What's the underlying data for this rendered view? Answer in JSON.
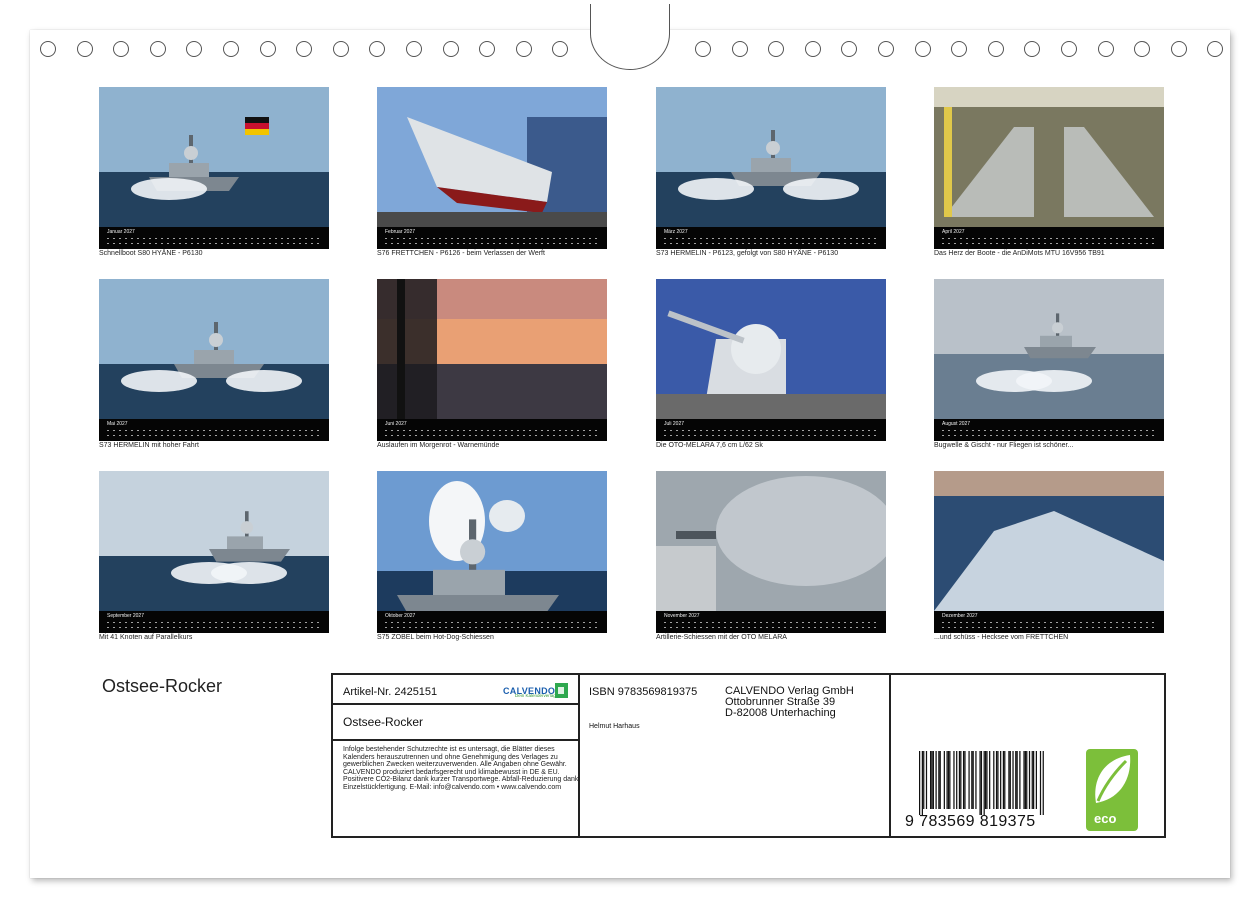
{
  "calendar": {
    "title": "Ostsee-Rocker",
    "months": [
      {
        "name": "Januar 2027",
        "caption": "Schnellboot S80 HYÄNE - P6130",
        "scene": "ship-flag"
      },
      {
        "name": "Februar 2027",
        "caption": "S76 FRETTCHEN  - P6126 - beim Verlassen der Werft",
        "scene": "shipyard"
      },
      {
        "name": "März 2027",
        "caption": "S73 HERMELIN - P6123, gefolgt von S80 HYÄNE - P6130",
        "scene": "ship-splash"
      },
      {
        "name": "April 2027",
        "caption": "Das Herz der Boote - die AnDiMots MTU 16V956 TB91",
        "scene": "engine-room"
      },
      {
        "name": "Mai 2027",
        "caption": "S73 HERMELIN mit hoher Fahrt",
        "scene": "ship-splash"
      },
      {
        "name": "Juni 2027",
        "caption": "Auslaufen im Morgenrot - Warnemünde",
        "scene": "sunset"
      },
      {
        "name": "Juli 2027",
        "caption": "Die OTO-MELARA 7,6 cm L/62 Sk",
        "scene": "gun"
      },
      {
        "name": "August 2027",
        "caption": "Bugwelle & Gischt - nur Fliegen ist schöner...",
        "scene": "ship-spray"
      },
      {
        "name": "September 2027",
        "caption": "Mit 41 Knoten auf Parallelkurs",
        "scene": "ship-fast"
      },
      {
        "name": "Oktober 2027",
        "caption": "S75 ZOBEL beim Hot-Dog-Schiessen",
        "scene": "smoke"
      },
      {
        "name": "November 2027",
        "caption": "Artillerie-Schiessen mit der OTO MELARA",
        "scene": "fog"
      },
      {
        "name": "Dezember 2027",
        "caption": "...und schüss - Hecksee vom FRETTCHEN",
        "scene": "wake"
      }
    ]
  },
  "info": {
    "article": "Artikel-Nr. 2425151",
    "brand": "CALVENDO",
    "brand_sub": "Dein Kalenderverlag",
    "product_title": "Ostsee-Rocker",
    "legal_text": "Infolge bestehender Schutzrechte ist es untersagt, die Blätter dieses Kalenders herauszutrennen und ohne Genehmigung des Verlages zu gewerblichen Zwecken weiterzuverwenden. Alle Angaben ohne Gewähr. CALVENDO produziert bedarfsgerecht und klimabewusst in DE & EU. Positivere CO2-Bilanz dank kurzer Transportwege. Abfall-Reduzierung dank Einzelstückfertigung. E-Mail: info@calvendo.com • www.calvendo.com",
    "isbn": "ISBN 9783569819375",
    "author": "Helmut Harhaus",
    "publisher": [
      "CALVENDO Verlag GmbH",
      "Ottobrunner Straße 39",
      "D-82008 Unterhaching"
    ],
    "barcode_number": "9  783569  819375",
    "eco_label": "eco"
  },
  "colors": {
    "eco_green": "#7cbf3a",
    "calendar_bar": "#050505",
    "brand_blue": "#1b5fae"
  }
}
